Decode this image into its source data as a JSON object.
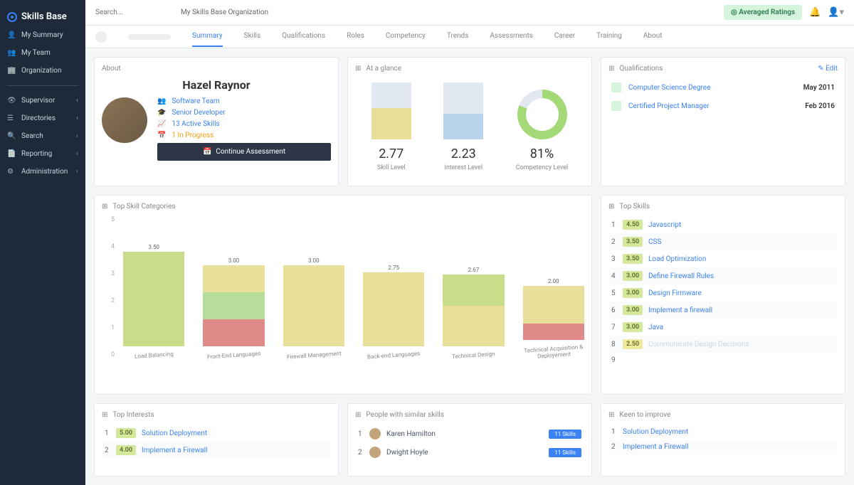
{
  "app_name": "Skills Base",
  "search": {
    "placeholder": "Search..."
  },
  "org_name": "My Skills Base Organization",
  "avg_ratings_btn": "Averaged Ratings",
  "sidebar": {
    "primary": [
      {
        "icon": "👤",
        "label": "My Summary"
      },
      {
        "icon": "👥",
        "label": "My Team"
      },
      {
        "icon": "🏢",
        "label": "Organization"
      }
    ],
    "secondary": [
      {
        "icon": "👁",
        "label": "Supervisor"
      },
      {
        "icon": "☰",
        "label": "Directories"
      },
      {
        "icon": "🔍",
        "label": "Search"
      },
      {
        "icon": "📄",
        "label": "Reporting"
      },
      {
        "icon": "⚙",
        "label": "Administration"
      }
    ]
  },
  "tabs": [
    "Summary",
    "Skills",
    "Qualifications",
    "Roles",
    "Competency",
    "Trends",
    "Assessments",
    "Career",
    "Training",
    "About"
  ],
  "active_tab": 0,
  "about": {
    "title": "About",
    "name": "Hazel Raynor",
    "team": "Software Team",
    "role": "Senior Developer",
    "skills": "13 Active Skills",
    "progress": "1 In Progress",
    "cta": "Continue Assessment"
  },
  "glance": {
    "title": "At a glance",
    "items": [
      {
        "value": "2.77",
        "label": "Skill Level",
        "fill": 55,
        "color": "#e8e09a"
      },
      {
        "value": "2.23",
        "label": "Interest Level",
        "fill": 45,
        "color": "#b8d4ec"
      },
      {
        "value": "81%",
        "label": "Competency Level",
        "donut": true
      }
    ]
  },
  "qualifications": {
    "title": "Qualifications",
    "edit": "Edit",
    "items": [
      {
        "name": "Computer Science Degree",
        "date": "May 2011"
      },
      {
        "name": "Certified Project Manager",
        "date": "Feb 2016"
      }
    ]
  },
  "chart_data": {
    "type": "bar",
    "title": "Top Skill Categories",
    "ylim": [
      0,
      5
    ],
    "categories": [
      "Load Balancing",
      "Front-End Languages",
      "Firewall Management",
      "Back-end Languages",
      "Technical Design",
      "Technical Acquisition & Deployement"
    ],
    "values": [
      3.5,
      3.0,
      3.0,
      2.75,
      2.67,
      2.0
    ],
    "segments": [
      [
        {
          "c": "#c8dc8a",
          "h": 3.5
        }
      ],
      [
        {
          "c": "#e08a8a",
          "h": 1.0
        },
        {
          "c": "#b8dc9a",
          "h": 1.0
        },
        {
          "c": "#e8e09a",
          "h": 1.0
        }
      ],
      [
        {
          "c": "#e8e09a",
          "h": 3.0
        }
      ],
      [
        {
          "c": "#e8e09a",
          "h": 2.75
        }
      ],
      [
        {
          "c": "#e8e09a",
          "h": 1.5
        },
        {
          "c": "#c8dc8a",
          "h": 1.17
        }
      ],
      [
        {
          "c": "#e08a8a",
          "h": 0.6
        },
        {
          "c": "#e8e09a",
          "h": 1.4
        }
      ]
    ]
  },
  "top_skills": {
    "title": "Top Skills",
    "items": [
      {
        "rank": "1",
        "score": "4.50",
        "name": "Javascript"
      },
      {
        "rank": "2",
        "score": "3.50",
        "name": "CSS"
      },
      {
        "rank": "3",
        "score": "3.50",
        "name": "Load Optimization"
      },
      {
        "rank": "4",
        "score": "3.00",
        "name": "Define Firewall Rules"
      },
      {
        "rank": "5",
        "score": "3.00",
        "name": "Design Firmware"
      },
      {
        "rank": "6",
        "score": "3.00",
        "name": "Implement a firewall"
      },
      {
        "rank": "7",
        "score": "3.00",
        "name": "Java"
      },
      {
        "rank": "8",
        "score": "2.50",
        "name": "Communicate Design Decisions",
        "faded": true
      },
      {
        "rank": "9",
        "score": "",
        "name": ""
      }
    ]
  },
  "top_interests": {
    "title": "Top Interests",
    "items": [
      {
        "rank": "1",
        "score": "5.00",
        "name": "Solution Deployment"
      },
      {
        "rank": "2",
        "score": "4.00",
        "name": "Implement a Firewall"
      }
    ]
  },
  "similar": {
    "title": "People with similar skills",
    "items": [
      {
        "rank": "1",
        "name": "Karen Hamilton",
        "pill": "11 Skills"
      },
      {
        "rank": "2",
        "name": "Dwight Hoyle",
        "pill": "11 Skills"
      }
    ]
  },
  "improve": {
    "title": "Keen to improve",
    "items": [
      {
        "rank": "1",
        "name": "Solution Deployment"
      },
      {
        "rank": "2",
        "name": "Implement a Firewall"
      }
    ]
  }
}
